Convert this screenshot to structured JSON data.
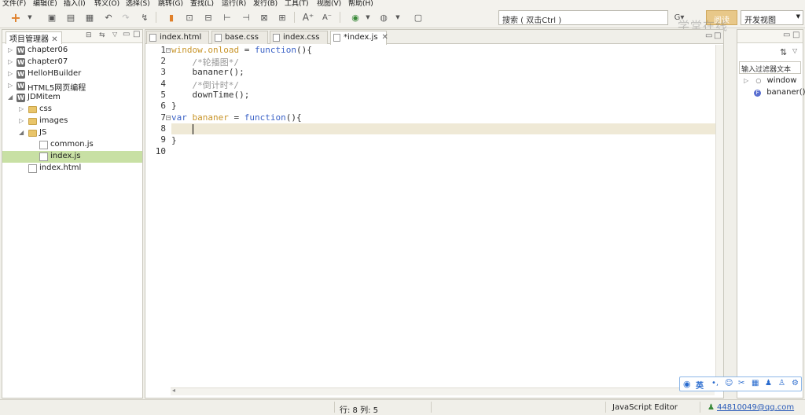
{
  "menu": [
    "文件(F)",
    "编辑(E)",
    "插入(I)",
    "转义(O)",
    "选择(S)",
    "跳转(G)",
    "查找(L)",
    "运行(R)",
    "发行(B)",
    "工具(T)",
    "视图(V)",
    "帮助(H)"
  ],
  "toolbar": {
    "search_placeholder": "搜索 ( 双击Ctrl )",
    "read_label": "阅读",
    "view_switch": "开发视图"
  },
  "watermark": "学堂在线",
  "left_panel": {
    "title": "项目管理器",
    "tree": [
      {
        "label": "chapter06",
        "type": "project",
        "expanded": false
      },
      {
        "label": "chapter07",
        "type": "project",
        "expanded": false
      },
      {
        "label": "HelloHBuilder",
        "type": "project",
        "expanded": false
      },
      {
        "label": "HTML5网页编程",
        "type": "project",
        "expanded": false
      },
      {
        "label": "JDMitem",
        "type": "project",
        "expanded": true
      },
      {
        "label": "css",
        "type": "folder",
        "expanded": false
      },
      {
        "label": "images",
        "type": "folder",
        "expanded": false
      },
      {
        "label": "JS",
        "type": "folder",
        "expanded": true
      },
      {
        "label": "common.js",
        "type": "file"
      },
      {
        "label": "index.js",
        "type": "file",
        "selected": true
      },
      {
        "label": "index.html",
        "type": "file"
      }
    ]
  },
  "editor": {
    "tabs": [
      {
        "label": "index.html",
        "active": false
      },
      {
        "label": "base.css",
        "active": false
      },
      {
        "label": "index.css",
        "active": false
      },
      {
        "label": "*index.js",
        "active": true
      }
    ],
    "line_numbers": [
      "1",
      "2",
      "3",
      "4",
      "5",
      "6",
      "7",
      "8",
      "9",
      "10"
    ],
    "code": {
      "l1_var": "window.onload",
      "l1_rest": " = ",
      "l1_kw": "function",
      "l1_end": "(){",
      "l2": "    /*轮播图*/",
      "l3": "    bananer();",
      "l4": "    /*倒计时*/",
      "l5": "    downTime();",
      "l6": "}",
      "l7_kw": "var",
      "l7_var": " bananer",
      "l7_rest": " = ",
      "l7_kw2": "function",
      "l7_end": "(){",
      "l9": "}"
    }
  },
  "right_panel": {
    "filter_placeholder": "输入过滤器文本",
    "outline": [
      {
        "label": "window",
        "icon": "circle-icon"
      },
      {
        "label": "bananer()",
        "icon": "function-icon"
      }
    ]
  },
  "status": {
    "position": "行: 8 列: 5",
    "editor_type": "JavaScript Editor",
    "user": "44810049@qq.com"
  },
  "ime": {
    "lang": "英"
  }
}
